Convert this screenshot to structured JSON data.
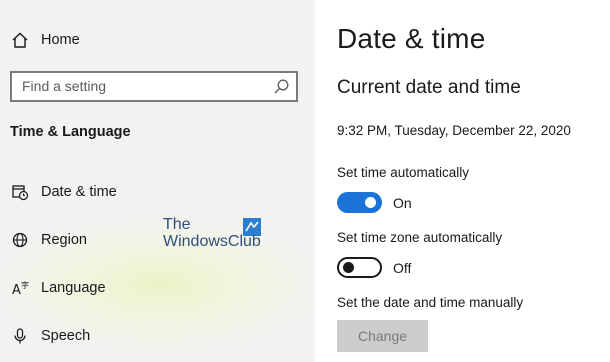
{
  "sidebar": {
    "home_label": "Home",
    "search_placeholder": "Find a setting",
    "section_title": "Time & Language",
    "items": [
      {
        "label": "Date & time",
        "icon": "calendar-clock-icon"
      },
      {
        "label": "Region",
        "icon": "globe-icon"
      },
      {
        "label": "Language",
        "icon": "language-icon"
      },
      {
        "label": "Speech",
        "icon": "microphone-icon"
      }
    ]
  },
  "watermark": {
    "line1": "The",
    "line2": "WindowsClub"
  },
  "main": {
    "title": "Date & time",
    "subheading": "Current date and time",
    "current_datetime": "9:32 PM, Tuesday, December 22, 2020",
    "set_time_auto": {
      "label": "Set time automatically",
      "state": "On",
      "on": true
    },
    "set_timezone_auto": {
      "label": "Set time zone automatically",
      "state": "Off",
      "on": false
    },
    "manual_label": "Set the date and time manually",
    "change_button": "Change"
  },
  "colors": {
    "accent": "#1a73d6",
    "sidebar_bg": "#f2f2f2",
    "disabled_button": "#cccccc"
  }
}
